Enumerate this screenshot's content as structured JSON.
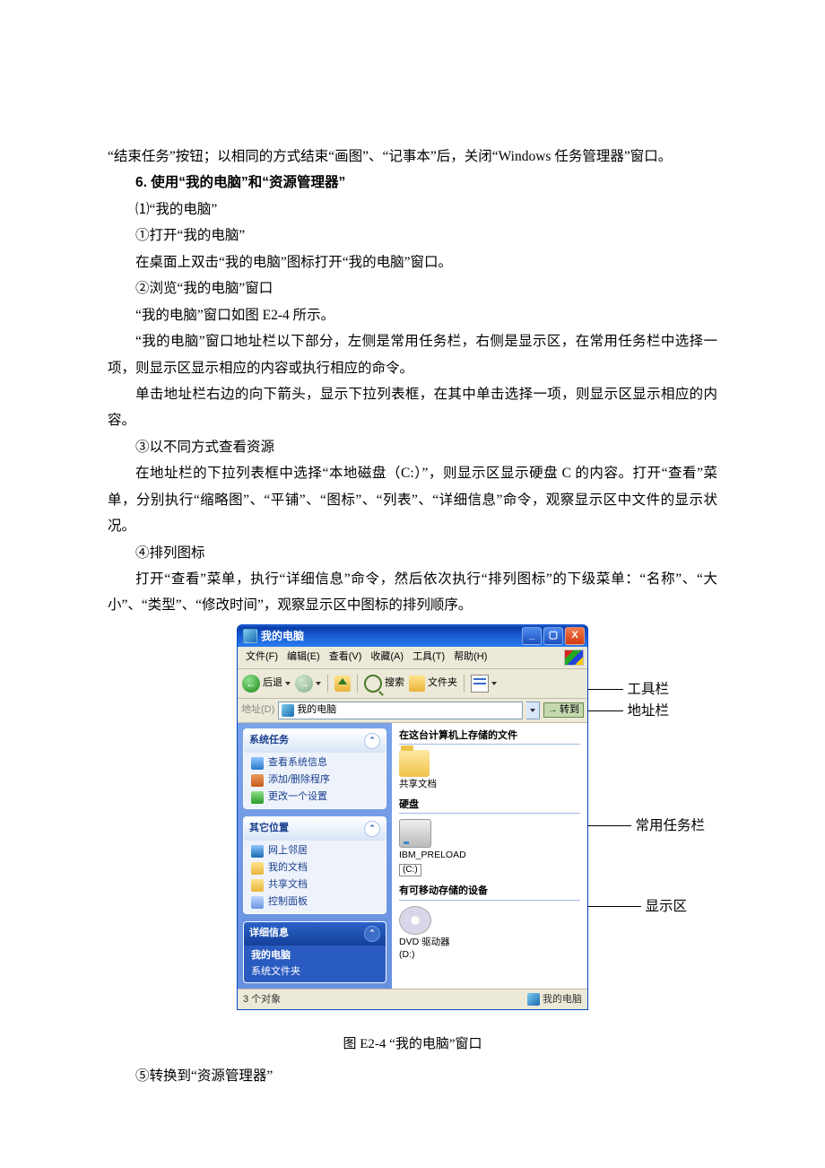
{
  "paragraphs": {
    "p0": "“结束任务”按钮；以相同的方式结束“画图”、“记事本”后，关闭“Windows 任务管理器”窗口。",
    "h6": "6. 使用“我的电脑”和“资源管理器”",
    "p1": "⑴“我的电脑”",
    "p2": "①打开“我的电脑”",
    "p3": "在桌面上双击“我的电脑”图标打开“我的电脑”窗口。",
    "p4": "②浏览“我的电脑”窗口",
    "p5": "“我的电脑”窗口如图 E2-4 所示。",
    "p6": "“我的电脑”窗口地址栏以下部分，左侧是常用任务栏，右侧是显示区，在常用任务栏中选择一项，则显示区显示相应的内容或执行相应的命令。",
    "p7": "单击地址栏右边的向下箭头，显示下拉列表框，在其中单击选择一项，则显示区显示相应的内容。",
    "p8": "③以不同方式查看资源",
    "p9": "在地址栏的下拉列表框中选择“本地磁盘（C:）”，则显示区显示硬盘 C 的内容。打开“查看”菜单，分别执行“缩略图”、“平铺”、“图标”、“列表”、“详细信息”命令，观察显示区中文件的显示状况。",
    "p10": "④排列图标",
    "p11": "打开“查看”菜单，执行“详细信息”命令，然后依次执行“排列图标”的下级菜单：“名称”、“大小”、“类型”、“修改时间”，观察显示区中图标的排列顺序。",
    "p12": "⑤转换到“资源管理器”"
  },
  "caption": "图 E2-4    “我的电脑”窗口",
  "annotations": {
    "toolbar": "工具栏",
    "addressbar": "地址栏",
    "taskpane": "常用任务栏",
    "displayarea": "显示区"
  },
  "window": {
    "title": "我的电脑",
    "menus": {
      "file": "文件(F)",
      "edit": "编辑(E)",
      "view": "查看(V)",
      "fav": "收藏(A)",
      "tools": "工具(T)",
      "help": "帮助(H)"
    },
    "toolbar": {
      "back": "后退",
      "search": "搜索",
      "folders": "文件夹"
    },
    "address": {
      "label": "地址(D)",
      "value": "我的电脑",
      "go": "转到"
    },
    "leftpane": {
      "systasks": {
        "title": "系统任务",
        "items": {
          "sysinfo": "查看系统信息",
          "addrem": "添加/删除程序",
          "change": "更改一个设置"
        }
      },
      "other": {
        "title": "其它位置",
        "items": {
          "net": "网上邻居",
          "mydocs": "我的文档",
          "shared": "共享文档",
          "cp": "控制面板"
        }
      },
      "details": {
        "title": "详细信息",
        "line1": "我的电脑",
        "line2": "系统文件夹"
      }
    },
    "rightpane": {
      "group1": "在这台计算机上存储的文件",
      "shared": "共享文档",
      "group2": "硬盘",
      "drive_name": "IBM_PRELOAD",
      "drive_letter": "(C:)",
      "group3": "有可移动存储的设备",
      "dvd_name": "DVD 驱动器",
      "dvd_letter": "(D:)"
    },
    "status": {
      "objects": "3 个对象",
      "location": "我的电脑"
    }
  }
}
